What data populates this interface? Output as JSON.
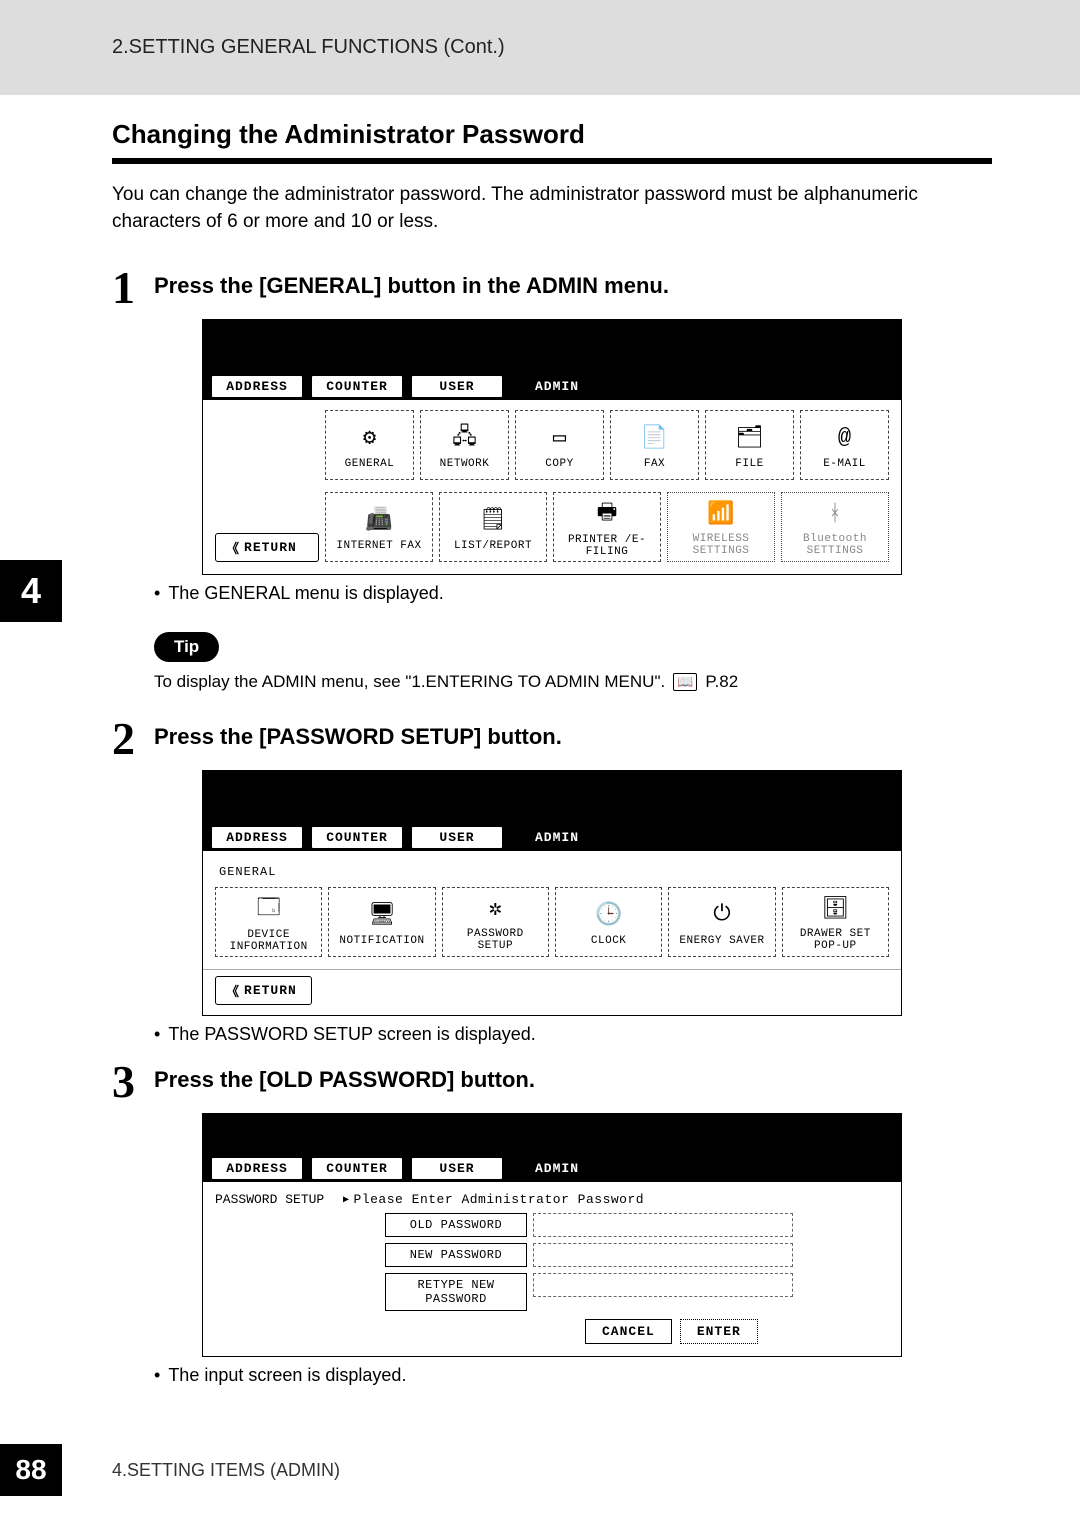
{
  "header_band": "2.SETTING GENERAL FUNCTIONS (Cont.)",
  "chapter": "4",
  "section_title": "Changing the Administrator Password",
  "intro": "You can change the administrator password.  The administrator password must be alphanumeric characters of 6 or more and 10 or less.",
  "step1": {
    "num": "1",
    "text": "Press the [GENERAL] button in the ADMIN menu.",
    "tabs": [
      "ADDRESS",
      "COUNTER",
      "USER",
      "ADMIN"
    ],
    "row1": [
      {
        "label": "GENERAL",
        "glyph": "⚙"
      },
      {
        "label": "NETWORK",
        "glyph": "🖧"
      },
      {
        "label": "COPY",
        "glyph": "▭"
      },
      {
        "label": "FAX",
        "glyph": "📄"
      },
      {
        "label": "FILE",
        "glyph": "🗂"
      },
      {
        "label": "E-MAIL",
        "glyph": "@"
      }
    ],
    "row2": [
      {
        "label": "INTERNET FAX",
        "glyph": "📠"
      },
      {
        "label": "LIST/REPORT",
        "glyph": "🗒"
      },
      {
        "label": "PRINTER /E-FILING",
        "glyph": "🖶"
      },
      {
        "label": "WIRELESS SETTINGS",
        "glyph": "📶",
        "dim": true
      },
      {
        "label": "Bluetooth SETTINGS",
        "glyph": "ᚼ",
        "dim": true
      }
    ],
    "return_label": "RETURN",
    "bullet": "The GENERAL menu is displayed."
  },
  "tip": {
    "tag": "Tip",
    "text": "To display the ADMIN menu, see \"1.ENTERING TO ADMIN MENU\".",
    "ref": "P.82"
  },
  "step2": {
    "num": "2",
    "text": "Press the [PASSWORD SETUP] button.",
    "tabs": [
      "ADDRESS",
      "COUNTER",
      "USER",
      "ADMIN"
    ],
    "crumb": "GENERAL",
    "items": [
      {
        "label": "DEVICE INFORMATION",
        "glyph": "🗔"
      },
      {
        "label": "NOTIFICATION",
        "glyph": "🖥"
      },
      {
        "label": "PASSWORD SETUP",
        "glyph": "✲"
      },
      {
        "label": "CLOCK",
        "glyph": "🕒"
      },
      {
        "label": "ENERGY SAVER",
        "glyph": "⏻"
      },
      {
        "label": "DRAWER SET POP-UP",
        "glyph": "🗄"
      }
    ],
    "return_label": "RETURN",
    "bullet": "The PASSWORD SETUP screen is displayed."
  },
  "step3": {
    "num": "3",
    "text": "Press the [OLD PASSWORD] button.",
    "tabs": [
      "ADDRESS",
      "COUNTER",
      "USER",
      "ADMIN"
    ],
    "crumb": "PASSWORD SETUP",
    "prompt": "Please Enter Administrator Password",
    "old": "OLD PASSWORD",
    "new": "NEW PASSWORD",
    "retype": "RETYPE NEW PASSWORD",
    "cancel": "CANCEL",
    "enter": "ENTER",
    "bullet": "The input screen is displayed."
  },
  "footer": {
    "page": "88",
    "chapter": "4.SETTING ITEMS (ADMIN)"
  }
}
